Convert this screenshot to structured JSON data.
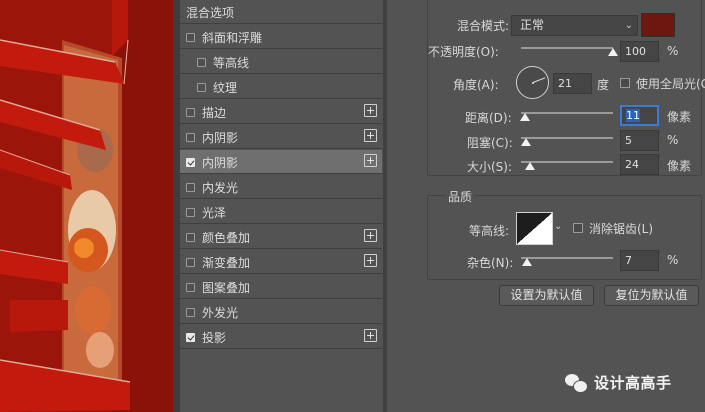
{
  "style_list": {
    "items": [
      {
        "label": "混合选项",
        "checkbox": false,
        "checked": false,
        "plus": false,
        "indent": 0,
        "active": false
      },
      {
        "label": "斜面和浮雕",
        "checkbox": true,
        "checked": false,
        "plus": false,
        "indent": 0,
        "active": false
      },
      {
        "label": "等高线",
        "checkbox": true,
        "checked": false,
        "plus": false,
        "indent": 1,
        "active": false
      },
      {
        "label": "纹理",
        "checkbox": true,
        "checked": false,
        "plus": false,
        "indent": 1,
        "active": false
      },
      {
        "label": "描边",
        "checkbox": true,
        "checked": false,
        "plus": true,
        "indent": 0,
        "active": false
      },
      {
        "label": "内阴影",
        "checkbox": true,
        "checked": false,
        "plus": true,
        "indent": 0,
        "active": false
      },
      {
        "label": "内阴影",
        "checkbox": true,
        "checked": true,
        "plus": true,
        "indent": 0,
        "active": true
      },
      {
        "label": "内发光",
        "checkbox": true,
        "checked": false,
        "plus": false,
        "indent": 0,
        "active": false
      },
      {
        "label": "光泽",
        "checkbox": true,
        "checked": false,
        "plus": false,
        "indent": 0,
        "active": false
      },
      {
        "label": "颜色叠加",
        "checkbox": true,
        "checked": false,
        "plus": true,
        "indent": 0,
        "active": false
      },
      {
        "label": "渐变叠加",
        "checkbox": true,
        "checked": false,
        "plus": true,
        "indent": 0,
        "active": false
      },
      {
        "label": "图案叠加",
        "checkbox": true,
        "checked": false,
        "plus": false,
        "indent": 0,
        "active": false
      },
      {
        "label": "外发光",
        "checkbox": true,
        "checked": false,
        "plus": false,
        "indent": 0,
        "active": false
      },
      {
        "label": "投影",
        "checkbox": true,
        "checked": true,
        "plus": true,
        "indent": 0,
        "active": false
      }
    ]
  },
  "structure": {
    "blend_mode_label": "混合模式:",
    "blend_mode_value": "正常",
    "blend_color": "#6e1610",
    "opacity_label": "不透明度(O):",
    "opacity_value": "100",
    "opacity_unit": "%",
    "opacity_fraction": 1.0,
    "angle_label": "角度(A):",
    "angle_value": "21",
    "angle_unit": "度",
    "global_light_label": "使用全局光(G",
    "distance_label": "距离(D):",
    "distance_value": "11",
    "distance_unit": "像素",
    "distance_fraction": 0.04,
    "choke_label": "阻塞(C):",
    "choke_value": "5",
    "choke_unit": "%",
    "choke_fraction": 0.05,
    "size_label": "大小(S):",
    "size_value": "24",
    "size_unit": "像素",
    "size_fraction": 0.1
  },
  "quality": {
    "title": "品质",
    "contour_label": "等高线:",
    "anti_alias_label": "消除锯齿(L)",
    "noise_label": "杂色(N):",
    "noise_value": "7",
    "noise_unit": "%",
    "noise_fraction": 0.07
  },
  "buttons": {
    "set_default": "设置为默认值",
    "reset_default": "复位为默认值"
  },
  "watermark": {
    "text": "设计高高手",
    "icon": "wechat-icon"
  },
  "colors": {
    "panel_bg": "#535353",
    "active_row": "#6f6f6f",
    "artwork_red": "#a8180b",
    "focus_blue": "#3b7bd6"
  }
}
